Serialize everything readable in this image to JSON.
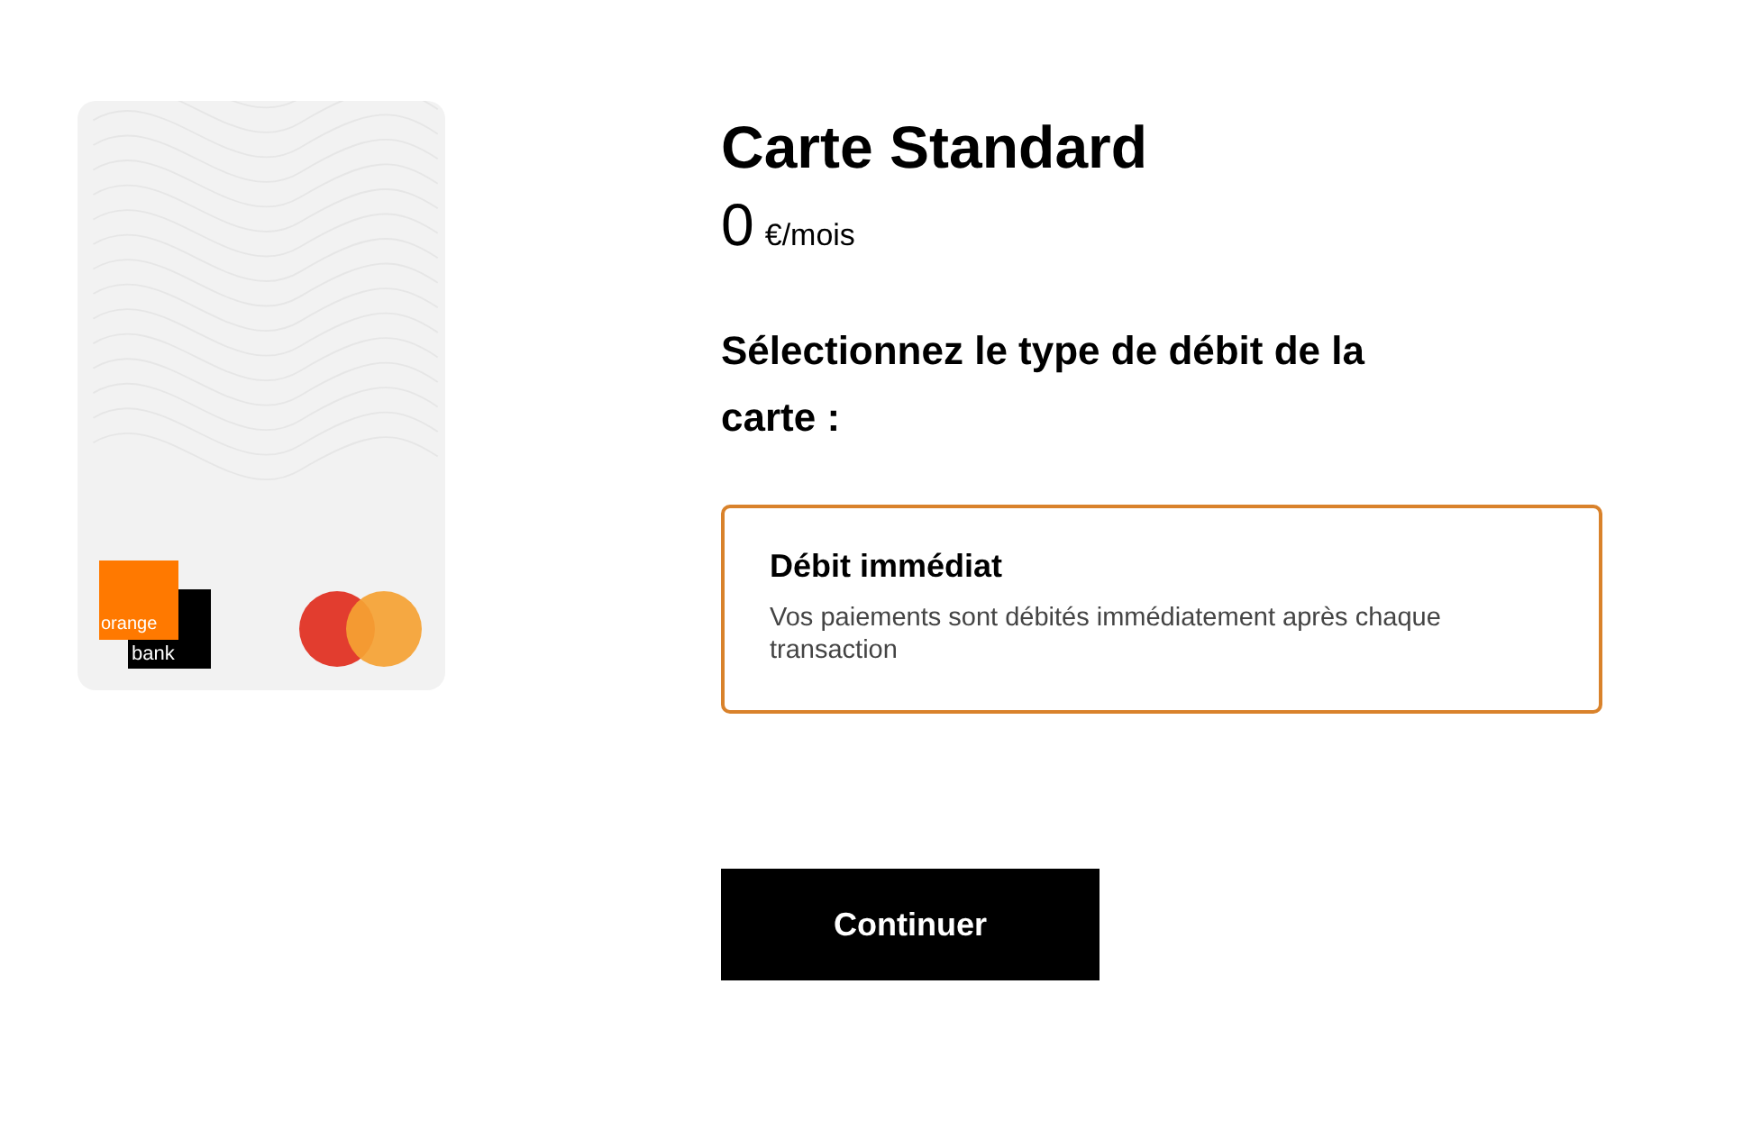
{
  "card": {
    "logo": {
      "top": "orange",
      "bottom": "bank"
    }
  },
  "title": "Carte Standard",
  "price": {
    "amount": "0",
    "unit": "€/mois"
  },
  "question": "Sélectionnez le type de débit de la carte :",
  "options": [
    {
      "title": "Débit immédiat",
      "description": "Vos paiements sont débités immédiatement après chaque transaction",
      "selected": true
    }
  ],
  "button": "Continuer"
}
